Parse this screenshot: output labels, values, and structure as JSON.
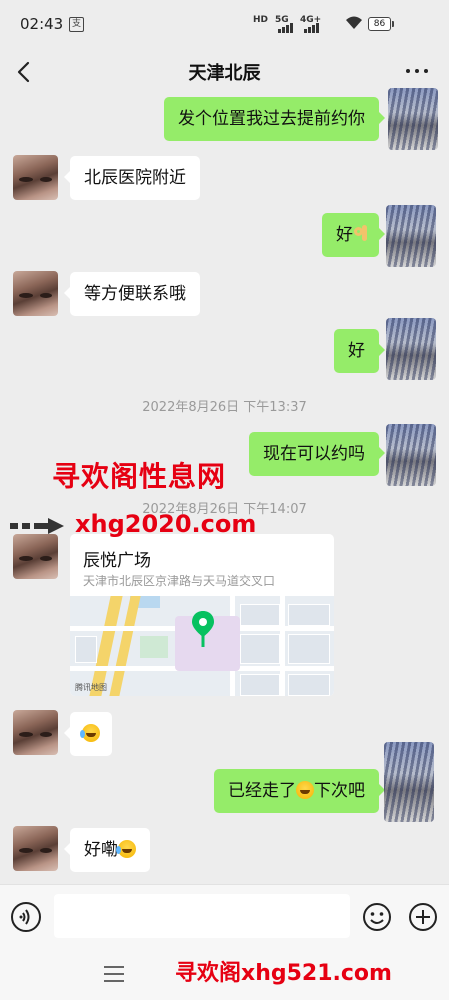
{
  "status_bar": {
    "time": "02:43",
    "alert_glyph": "支",
    "net1": "HD",
    "net2": "5G",
    "net3": "4G+",
    "battery": "86"
  },
  "header": {
    "title": "天津北辰"
  },
  "messages": {
    "m1": "发个位置我过去提前约你",
    "m2": "北辰医院附近",
    "m3": "好",
    "m4": "等方便联系哦",
    "m5": "好",
    "t1": "2022年8月26日 下午13:37",
    "m6": "现在可以约吗",
    "t2": "2022年8月26日 下午14:07",
    "m8a": "已经走了",
    "m8b": "下次吧",
    "m9": "好嘞"
  },
  "location": {
    "name": "辰悦广场",
    "address": "天津市北辰区京津路与天马道交叉口",
    "map_attribution": "腾讯地图"
  },
  "watermarks": {
    "line1": "寻欢阁性息网",
    "line2": "xhg2020.com",
    "bottom": "寻欢阁xhg521.com"
  },
  "input": {
    "placeholder": ""
  },
  "colors": {
    "outgoing_bubble": "#95ec69",
    "incoming_bubble": "#ffffff",
    "background": "#ededed",
    "watermark": "#e60012"
  },
  "icons": [
    "back-icon",
    "more-icon",
    "voice-icon",
    "emoji-icon",
    "plus-icon",
    "menu-icon",
    "location-pin-icon"
  ]
}
